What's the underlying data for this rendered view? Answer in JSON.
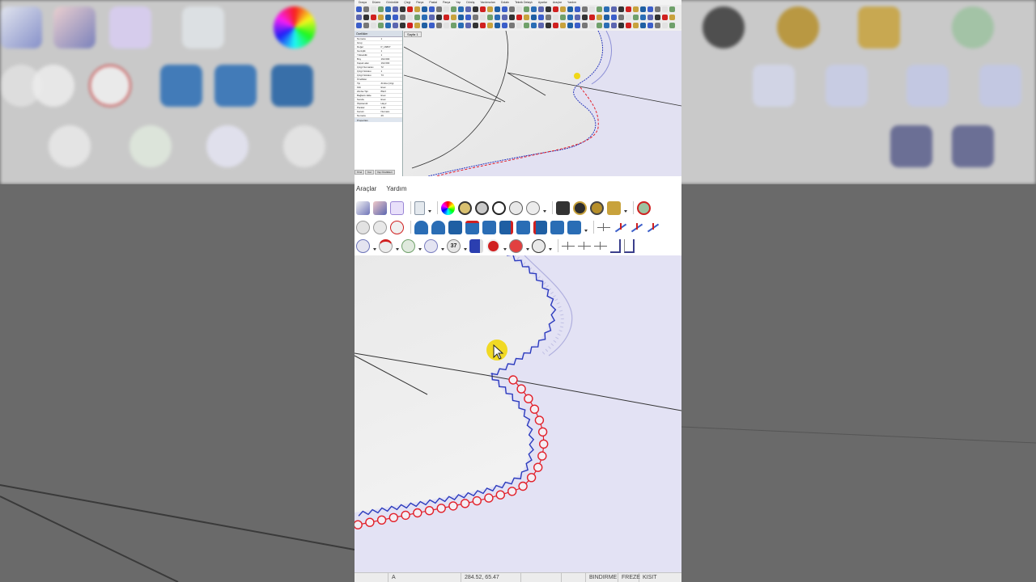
{
  "main_window": {
    "menu": [
      "Araçlar",
      "Yardım"
    ],
    "toolbar_rows": [
      [
        "pattern-grade-icon",
        "pattern-copy-icon",
        "pattern-split-icon",
        "document-icon",
        "color-wheel-icon",
        "measure-icon",
        "marker-icon",
        "barcode-icon",
        "zoom-icon",
        "table-icon",
        "print-icon",
        "plotter-icon",
        "camera-icon",
        "cut-icon",
        "settings-icon"
      ],
      [
        "notch-icon",
        "notch-two-icon",
        "notch-half-icon",
        "dart-icon",
        "dart-fold-icon",
        "pleat-icon",
        "seam-icon",
        "seam-add-icon",
        "corner-icon",
        "mirror-icon",
        "seam-corner-icon",
        "seam-rotate-icon",
        "seam-end-icon",
        "line-cross-icon",
        "line-diagonal-icon",
        "line-rotate-icon",
        "line-break-icon"
      ],
      [
        "knife-icon",
        "drill-icon",
        "button-icon",
        "circle-cut-icon",
        "number-37-icon",
        "magnet-icon",
        "eye-icon",
        "hanger-icon",
        "align-icon",
        "distance-icon",
        "grid-icon",
        "corner-bracket-icon",
        "square-corner-icon"
      ]
    ],
    "toolbar_number_badge": "37",
    "status": {
      "mode_letter": "A",
      "coordinates": "284.52, 65.47",
      "bindirme": "BINDIRME",
      "freze": "FREZE",
      "kisit": "KISIT"
    }
  },
  "mini_window": {
    "menu": [
      "Dosya",
      "Düzen",
      "Görüntüle",
      "Çizgi",
      "Parça",
      "Pastal",
      "Parça",
      "Yap",
      "Dönüş",
      "Yardımcıları",
      "Dolabı",
      "Teknik Detaylı",
      "Ayarlar",
      "Araçlar",
      "Yardım"
    ],
    "panel_title": "Özellikler",
    "panel_rows": [
      [
        "Numara",
        "1"
      ],
      [
        "Grup",
        ""
      ],
      [
        "Değer",
        "P_16807"
      ],
      [
        "Genişlik",
        "1"
      ],
      [
        "Yükseklik",
        "1"
      ],
      [
        "Boy",
        "192.000"
      ],
      [
        "Kapalı alan",
        "192.000"
      ],
      [
        "Çizgi Numarası",
        "72"
      ],
      [
        "Çizgi Noktası",
        "1"
      ],
      [
        "Çizgi Noktası",
        "73"
      ],
      [
        "Özellikler",
        ""
      ],
      [
        "Tip",
        "Zimba Çizgi"
      ],
      [
        "Kilit",
        "Evet"
      ],
      [
        "Zimba Tipi",
        "BWJ"
      ],
      [
        "Bağlantı Ekle",
        "Evet"
      ],
      [
        "Sonda",
        "Evet"
      ],
      [
        "Ölçülendir",
        "Hayır"
      ],
      [
        "Paralel",
        "1.00"
      ],
      [
        "Kenarı",
        "Numara"
      ],
      [
        "Numara",
        "29"
      ]
    ],
    "panel_footer": "Properties",
    "panel_tabs": [
      "Özel",
      "Kat",
      "Yap Özellikleri"
    ],
    "canvas_tab": "Sayfa 1"
  },
  "colors": {
    "notch_blue": "#2c3bbd",
    "drill_red": "#e2202a",
    "cursor_yellow": "#f1d500",
    "canvas_lavender": "#e3e2f4",
    "canvas_gray": "#e9e9e9"
  }
}
